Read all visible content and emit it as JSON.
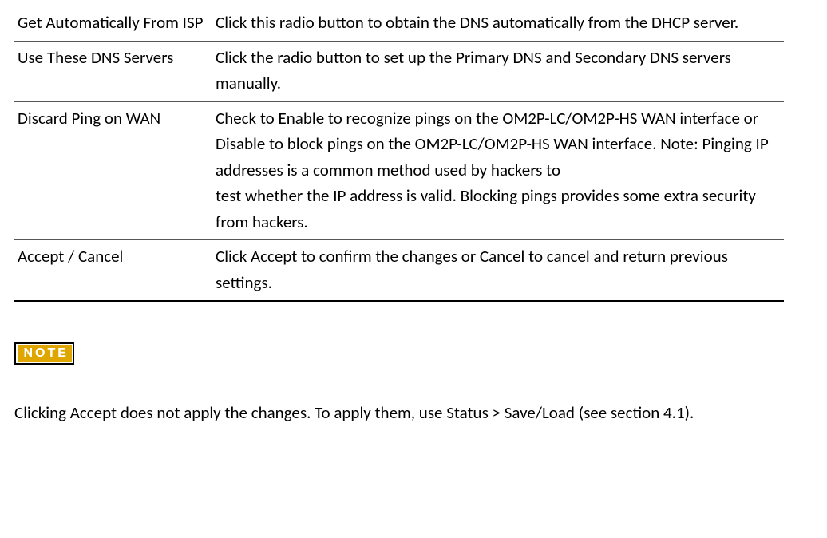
{
  "rows": [
    {
      "label": "Get Automatically From ISP",
      "desc": "Click this radio button to obtain the DNS automatically from the DHCP server."
    },
    {
      "label": "Use These DNS Servers",
      "desc": "Click the radio button to set up the Primary DNS and Secondary DNS servers manually."
    },
    {
      "label": "Discard Ping on WAN",
      "desc": "Check to Enable to recognize pings on the OM2P-LC/OM2P-HS WAN interface or Disable to block pings on the OM2P-LC/OM2P-HS WAN interface. Note: Pinging IP addresses is a common method used by hackers to\ntest whether the IP address is valid. Blocking pings provides some extra security from hackers."
    },
    {
      "label": "Accept / Cancel",
      "desc": "Click Accept to confirm the changes or Cancel to cancel and return previous settings."
    }
  ],
  "noteLabel": "NOTE",
  "noteBody": "Clicking Accept does not apply the changes. To apply them, use Status > Save/Load (see section 4.1)."
}
